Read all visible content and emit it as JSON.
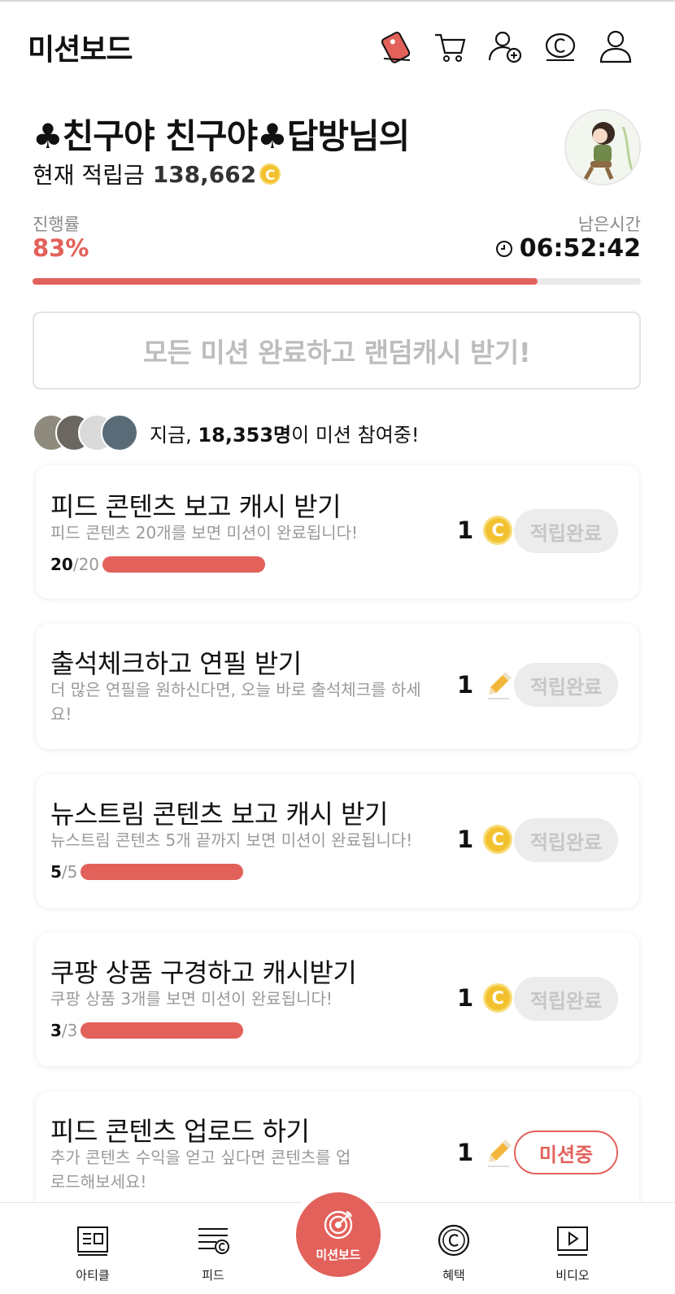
{
  "header": {
    "title": "미션보드",
    "icons": [
      "ticket-icon",
      "cart-icon",
      "add-friend-icon",
      "cash-icon",
      "profile-icon"
    ]
  },
  "user": {
    "name": "♣친구야 친구야♣답방님의",
    "balance_label": "현재 적립금",
    "balance_value": "138,662",
    "coin_symbol": "C"
  },
  "progress": {
    "label": "진행률",
    "value": "83%",
    "fraction": 0.83,
    "remaining_label": "남은시간",
    "remaining_value": "06:52:42"
  },
  "bonus_button": "모든 미션 완료하고 랜덤캐시 받기!",
  "participants": {
    "prefix": "지금, ",
    "count": "18,353명",
    "suffix": "이 미션 참여중!"
  },
  "missions": [
    {
      "title": "피드 콘텐츠 보고 캐시 받기",
      "desc": "피드 콘텐츠 20개를 보면 미션이 완료됩니다!",
      "current": "20",
      "total": "/20",
      "reward": "1",
      "reward_icon": "coin-icon",
      "status": "적립완료"
    },
    {
      "title": "출석체크하고 연필 받기",
      "desc": "더 많은 연필을 원하신다면, 오늘 바로 출석체크를 하세요!",
      "reward": "1",
      "reward_icon": "pencil-icon",
      "status": "적립완료"
    },
    {
      "title": "뉴스트림 콘텐츠 보고 캐시 받기",
      "desc": "뉴스트림 콘텐츠 5개 끝까지 보면 미션이 완료됩니다!",
      "current": "5",
      "total": "/5",
      "reward": "1",
      "reward_icon": "coin-icon",
      "status": "적립완료"
    },
    {
      "title": "쿠팡 상품 구경하고 캐시받기",
      "desc": "쿠팡 상품 3개를 보면 미션이 완료됩니다!",
      "current": "3",
      "total": "/3",
      "reward": "1",
      "reward_icon": "coin-icon",
      "status": "적립완료"
    },
    {
      "title": "피드 콘텐츠 업로드 하기",
      "desc": "추가 콘텐츠 수익을 얻고 싶다면 콘텐츠를 업로드해보세요!",
      "reward": "1",
      "reward_icon": "pencil-icon",
      "status": "미션중"
    }
  ],
  "nav": {
    "article": "아티클",
    "feed": "피드",
    "missionboard": "미션보드",
    "benefit": "혜택",
    "video": "비디오"
  },
  "colors": {
    "accent": "#e3615b",
    "coin": "#f3c12f",
    "muted": "#9a9a9a"
  }
}
